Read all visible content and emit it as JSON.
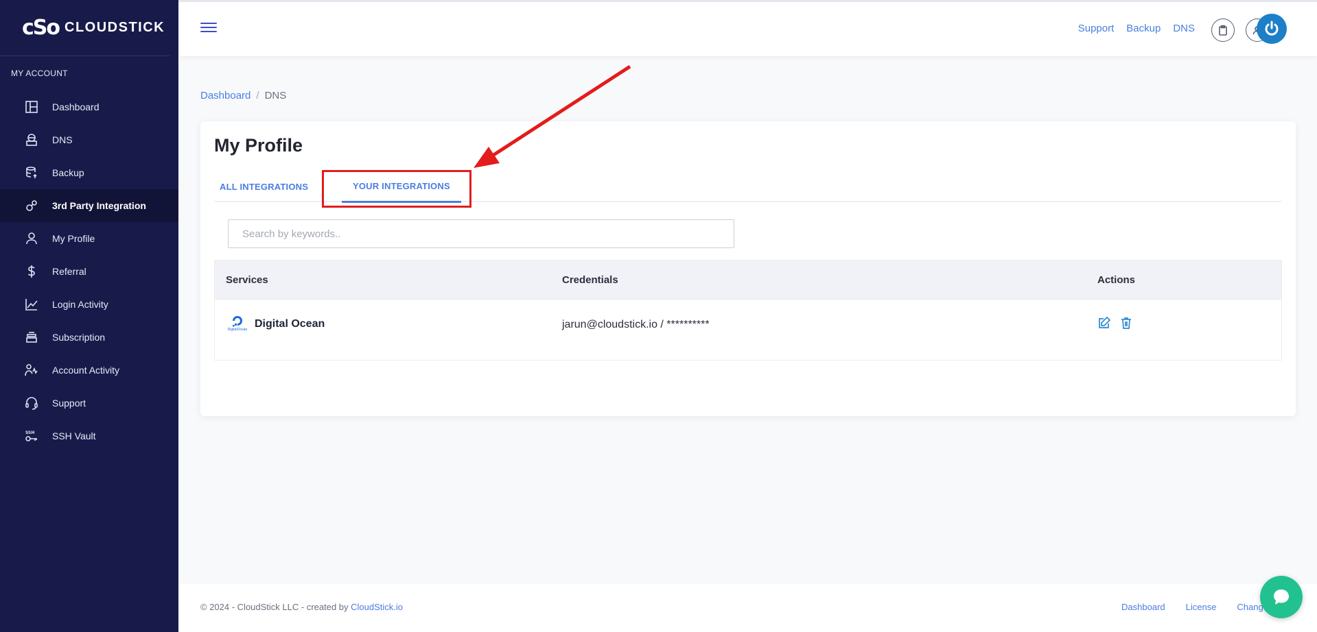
{
  "brand": {
    "mark": "cSo",
    "name": "CLOUDSTICK"
  },
  "sidebar": {
    "section": "MY ACCOUNT",
    "items": [
      {
        "label": "Dashboard",
        "icon": "dashboard-icon"
      },
      {
        "label": "DNS",
        "icon": "dns-icon"
      },
      {
        "label": "Backup",
        "icon": "backup-icon"
      },
      {
        "label": "3rd Party Integration",
        "icon": "integration-icon",
        "active": true
      },
      {
        "label": "My Profile",
        "icon": "user-icon"
      },
      {
        "label": "Referral",
        "icon": "dollar-icon"
      },
      {
        "label": "Login Activity",
        "icon": "chart-icon"
      },
      {
        "label": "Subscription",
        "icon": "subscription-icon"
      },
      {
        "label": "Account Activity",
        "icon": "activity-icon"
      },
      {
        "label": "Support",
        "icon": "headset-icon"
      },
      {
        "label": "SSH Vault",
        "icon": "ssh-key-icon"
      }
    ]
  },
  "topbar": {
    "links": [
      "Support",
      "Backup",
      "DNS"
    ]
  },
  "breadcrumb": {
    "parent": "Dashboard",
    "separator": "/",
    "current": "DNS"
  },
  "page": {
    "title": "My Profile",
    "tabs": [
      "ALL INTEGRATIONS",
      "YOUR INTEGRATIONS"
    ],
    "search_placeholder": "Search by keywords..",
    "table": {
      "headers": [
        "Services",
        "Credentials",
        "Actions"
      ],
      "rows": [
        {
          "service": "Digital Ocean",
          "logo_caption": "DigitalOcean",
          "credentials": "jarun@cloudstick.io / **********"
        }
      ]
    }
  },
  "footer": {
    "copy": "© 2024 - CloudStick LLC - created by",
    "copy_link": "CloudStick.io",
    "links": [
      "Dashboard",
      "License",
      "Chang"
    ]
  },
  "colors": {
    "sidebar": "#181b4a",
    "accent": "#4a7ee0",
    "annotation": "#e31c1c",
    "chat": "#21c28f"
  }
}
